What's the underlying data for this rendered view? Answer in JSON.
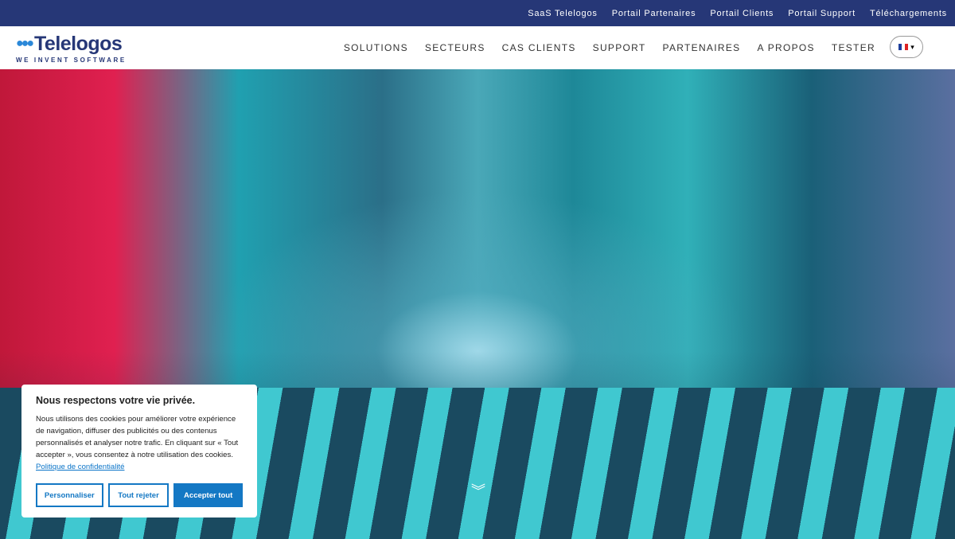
{
  "topbar": {
    "links": [
      "SaaS Telelogos",
      "Portail Partenaires",
      "Portail Clients",
      "Portail Support",
      "Téléchargements"
    ]
  },
  "header": {
    "logo": "Telelogos",
    "tagline": "WE INVENT SOFTWARE",
    "nav": [
      "SOLUTIONS",
      "SECTEURS",
      "CAS CLIENTS",
      "SUPPORT",
      "PARTENAIRES",
      "A PROPOS",
      "TESTER"
    ],
    "lang_caret": "▾"
  },
  "hero": {
    "scroll_icon": "︾"
  },
  "cookie": {
    "title": "Nous respectons votre vie privée.",
    "text": "Nous utilisons des cookies pour améliorer votre expérience de navigation, diffuser des publicités ou des contenus personnalisés et analyser notre trafic. En cliquant sur « Tout accepter », vous consentez à notre utilisation des cookies.",
    "link": "Politique de confidentialité",
    "customize": "Personnaliser",
    "reject": "Tout rejeter",
    "accept": "Accepter tout"
  }
}
